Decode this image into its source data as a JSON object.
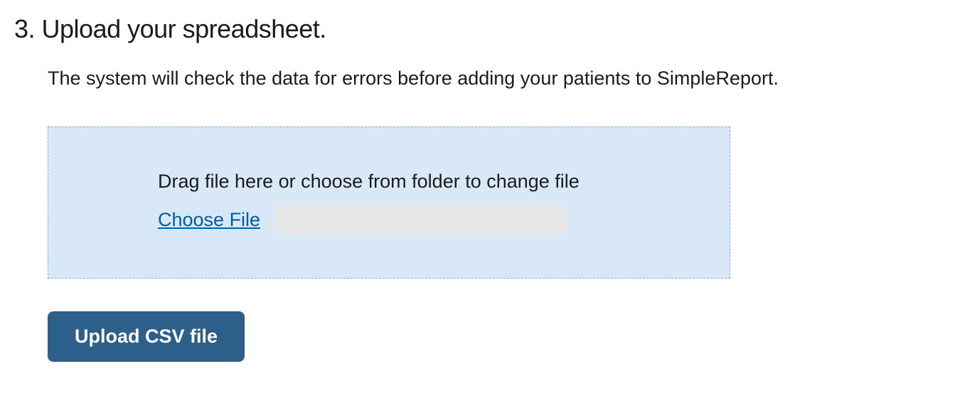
{
  "step": {
    "heading": "3. Upload your spreadsheet.",
    "instruction": "The system will check the data for errors before adding your patients to SimpleReport."
  },
  "dropzone": {
    "label": "Drag file here or choose from folder to change file",
    "choose_file_label": "Choose File"
  },
  "actions": {
    "upload_button_label": "Upload CSV file"
  }
}
